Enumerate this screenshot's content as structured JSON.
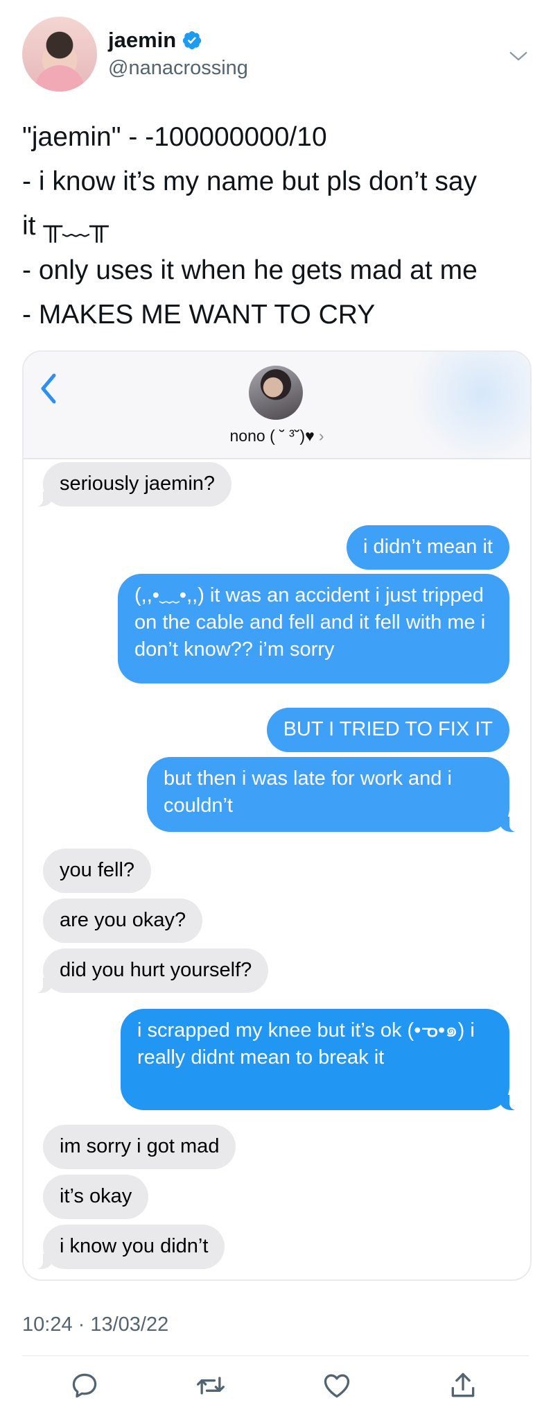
{
  "user": {
    "display_name": "jaemin",
    "handle": "@nanacrossing"
  },
  "tweet": {
    "lines": [
      "\"jaemin\" - -100000000/10",
      "- i know it’s my name but pls don’t say",
      "it ╥﹏╥",
      "- only uses it when he gets mad at me",
      "- MAKES ME WANT TO CRY"
    ],
    "timestamp": "10:24 · 13/03/22"
  },
  "conversation": {
    "contact_name": "nono ( ˘ ³˘)♥",
    "contact_chevron": "›",
    "messages": [
      {
        "from": "them",
        "text": "seriously jaemin?"
      },
      {
        "from": "me",
        "text": "i didn’t mean it"
      },
      {
        "from": "me",
        "text": "(,,•﹏•,,) it was an accident i just tripped on the cable and fell and it fell with me i don’t know?? i’m sorry"
      },
      {
        "from": "me",
        "text": "BUT I TRIED TO FIX IT"
      },
      {
        "from": "me",
        "text": "but then i was late for work and i couldn’t"
      },
      {
        "from": "them",
        "text": "you fell?"
      },
      {
        "from": "them",
        "text": "are you okay?"
      },
      {
        "from": "them",
        "text": "did you hurt yourself?"
      },
      {
        "from": "me",
        "text": "i scrapped my knee but it’s ok (•ᓀ•๑) i really didnt mean to break it"
      },
      {
        "from": "them",
        "text": "im sorry i got mad"
      },
      {
        "from": "them",
        "text": "it’s okay"
      },
      {
        "from": "them",
        "text": "i know you didn’t"
      }
    ]
  },
  "icons": {
    "verified": "verified-badge-icon",
    "more": "chevron-down-icon",
    "back": "back-chevron-icon",
    "reply": "reply-icon",
    "retweet": "retweet-icon",
    "like": "like-icon",
    "share": "share-icon"
  },
  "colors": {
    "verified": "#1d9bf0",
    "sent_bubble": "#3ea0f7",
    "received_bubble": "#e9e9eb",
    "secondary_text": "#536471"
  }
}
